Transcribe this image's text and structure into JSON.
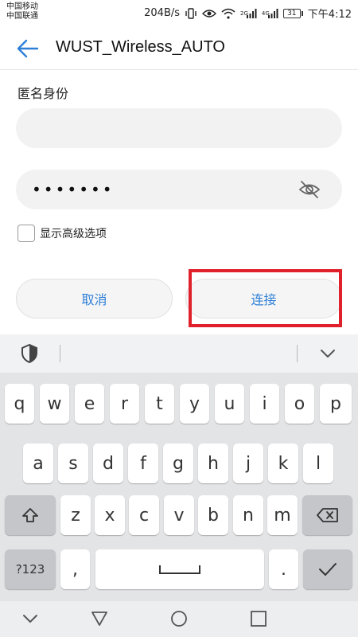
{
  "status_bar": {
    "carrier_1": "中国移动",
    "carrier_2": "中国联通",
    "speed": "204B/s",
    "net_2g": "2G",
    "net_4g": "4G",
    "battery": "31",
    "time": "下午4:12"
  },
  "header": {
    "title": "WUST_Wireless_AUTO",
    "back_icon": "arrow-left-icon"
  },
  "form": {
    "identity_label": "匿名身份",
    "identity_value": "",
    "password_value": "•••••••",
    "show_advanced_label": "显示高级选项",
    "show_advanced_checked": false
  },
  "buttons": {
    "cancel": "取消",
    "connect": "连接"
  },
  "colors": {
    "accent": "#2d7fd8",
    "highlight": "#e0202a",
    "input_bg": "#f2f2f2"
  },
  "keyboard": {
    "row1": [
      "q",
      "w",
      "e",
      "r",
      "t",
      "y",
      "u",
      "i",
      "o",
      "p"
    ],
    "row2": [
      "a",
      "s",
      "d",
      "f",
      "g",
      "h",
      "j",
      "k",
      "l"
    ],
    "row3": [
      "z",
      "x",
      "c",
      "v",
      "b",
      "n",
      "m"
    ],
    "symbols_label": "?123",
    "comma": ",",
    "period": "."
  }
}
